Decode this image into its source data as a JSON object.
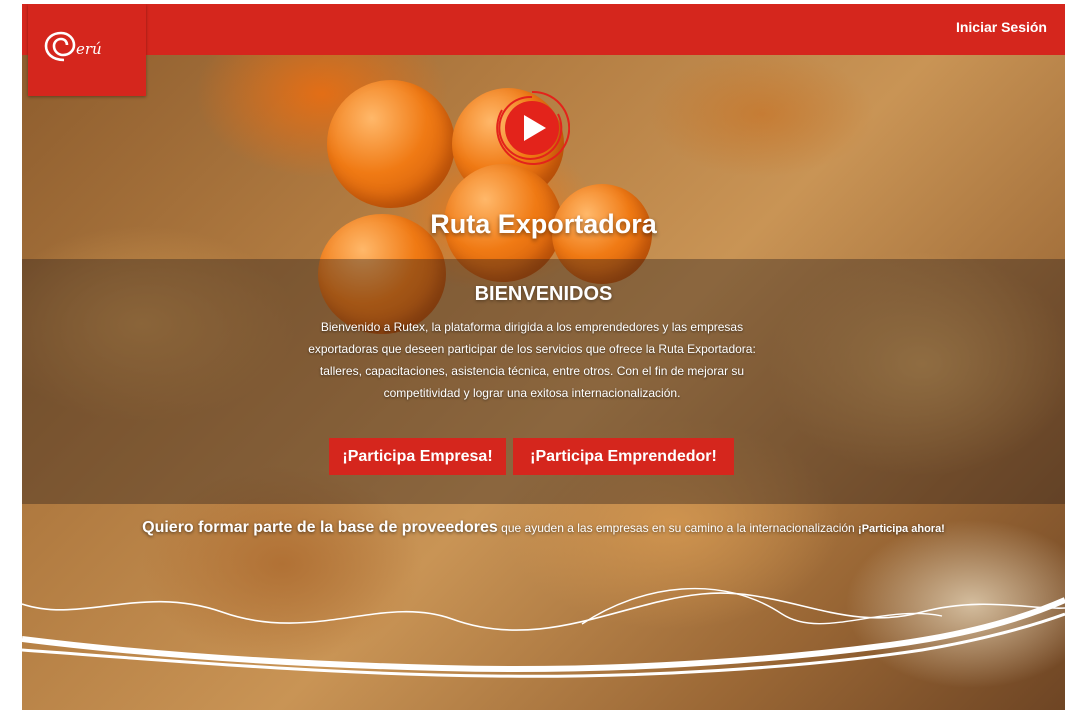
{
  "header": {
    "login_label": "Iniciar Sesión",
    "logo_icon": "peru-brand-logo",
    "brand_color": "#d5261d"
  },
  "hero": {
    "play_icon": "play-icon",
    "title": "Ruta Exportadora",
    "welcome_heading": "BIENVENIDOS",
    "welcome_text": "Bienvenido a Rutex, la plataforma dirigida a los emprendedores y las empresas exportadoras que deseen participar de los servicios que ofrece la Ruta Exportadora: talleres, capacitaciones, asistencia técnica, entre otros. Con el fin de mejorar su competitividad y lograr una exitosa internacionalización.",
    "cta_company_label": "¡Participa Empresa!",
    "cta_entrepreneur_label": "¡Participa Emprendedor!"
  },
  "providers": {
    "lead": "Quiero formar parte de la base de proveedores",
    "text": " que ayuden a las empresas en su camino a la internacionalización ",
    "link_label": "¡Participa ahora!"
  }
}
